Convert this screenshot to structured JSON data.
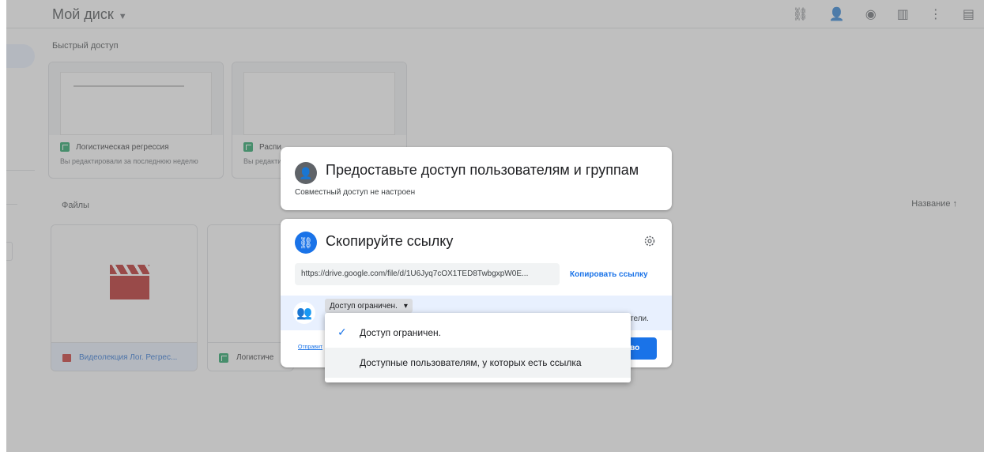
{
  "header": {
    "title": "Мой диск",
    "icons": [
      "link-icon",
      "add-person-icon",
      "eye-icon",
      "trash-icon",
      "more-icon",
      "details-icon"
    ]
  },
  "quick_access": {
    "title": "Быстрый доступ",
    "cards": [
      {
        "name": "Логистическая регрессия",
        "sub": "Вы редактировали за последнюю неделю",
        "icon": "sheets-icon"
      },
      {
        "name": "Распи",
        "sub": "Вы редакти",
        "icon": "sheets-icon"
      }
    ]
  },
  "files": {
    "title": "Файлы",
    "sort_label": "Название",
    "items": [
      {
        "name": "Видеолекция Лог. Регрес...",
        "icon": "video-icon"
      },
      {
        "name": "Логистиче",
        "icon": "sheets-icon"
      }
    ]
  },
  "share_dialog": {
    "title": "Предоставьте доступ пользователям и группам",
    "subtitle": "Совместный доступ не настроен"
  },
  "copy_dialog": {
    "title": "Скопируйте ссылку",
    "link": "https://drive.google.com/file/d/1U6Jyq7cOX1TED8TwbgxpW0E...",
    "copy_label": "Копировать ссылку",
    "access_value": "Доступ ограничен.",
    "access_tail": "тели.",
    "send_label": "Отправит",
    "done_label": "ово"
  },
  "access_menu": {
    "options": [
      "Доступ ограничен.",
      "Доступные пользователям, у которых есть ссылка"
    ],
    "selected_index": 0
  },
  "colors": {
    "accent": "#1a73e8",
    "selected_bg": "#e8f0fe",
    "sheets": "#0f9d58",
    "video": "#c5221f"
  }
}
